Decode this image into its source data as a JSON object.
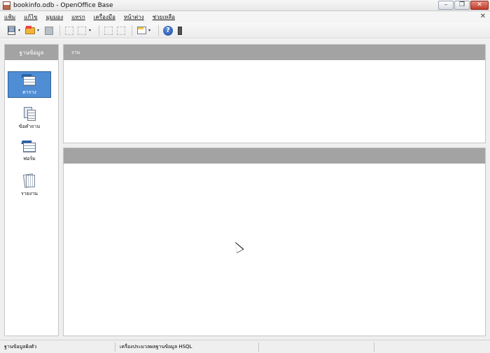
{
  "window": {
    "title": "bookinfo.odb - OpenOffice Base",
    "controls": {
      "minimize": "–",
      "restore": "❐",
      "close": "✕"
    }
  },
  "menu": {
    "items": [
      "แฟ้ม",
      "แก้ไข",
      "มุมมอง",
      "แทรก",
      "เครื่องมือ",
      "หน้าต่าง",
      "ช่วยเหลือ"
    ],
    "doc_close": "✕"
  },
  "toolbar": {
    "icons": [
      "new-icon",
      "open-icon",
      "save-icon",
      "copy-icon",
      "paste-icon",
      "sort-ascending-icon",
      "sort-descending-icon",
      "form-icon",
      "help-icon"
    ],
    "help_glyph": "?",
    "dropdown_glyph": "▾"
  },
  "sidebar": {
    "header": "ฐานข้อมูล",
    "items": [
      {
        "label": "ตาราง",
        "icon": "table-icon",
        "selected": true
      },
      {
        "label": "ข้อคำถาม",
        "icon": "query-icon",
        "selected": false
      },
      {
        "label": "ฟอร์ม",
        "icon": "form-icon",
        "selected": false
      },
      {
        "label": "รายงาน",
        "icon": "report-icon",
        "selected": false
      }
    ]
  },
  "tasks": {
    "header": "งาน"
  },
  "content": {
    "header": ""
  },
  "statusbar": {
    "cells": [
      "ฐานข้อมูลฝังตัว",
      "เครื่องประมวลผลฐานข้อมูล HSQL",
      "",
      ""
    ]
  },
  "colors": {
    "panel_header": "#a3a3a3",
    "selection": "#4f8ed4",
    "background": "#efefef"
  }
}
